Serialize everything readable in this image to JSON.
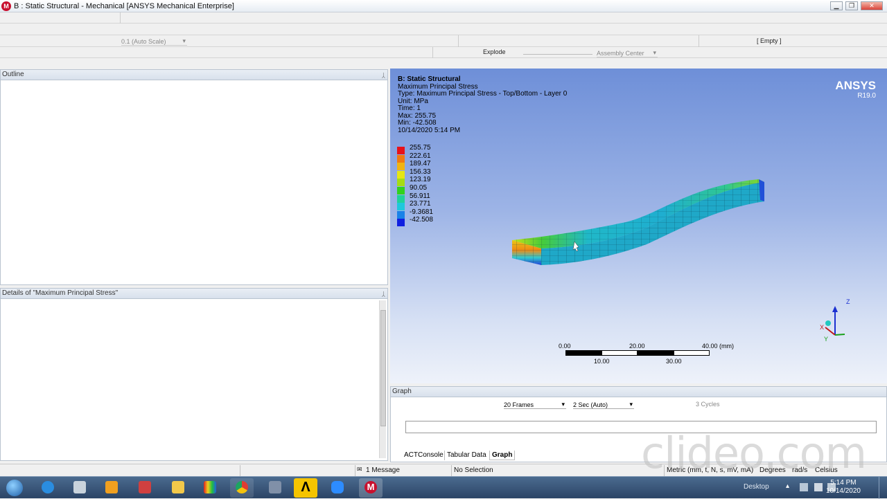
{
  "window": {
    "title": "B : Static Structural - Mechanical [ANSYS Mechanical Enterprise]",
    "app_icon_letter": "M",
    "min": "▁",
    "restore": "❐",
    "close": "✕"
  },
  "toolbar": {
    "scale": "0.1 (Auto Scale)",
    "empty": "[ Empty ]",
    "explode": "Explode",
    "assembly_center": "Assembly Center"
  },
  "outline": {
    "header": "Outline",
    "pin": "ᛸ"
  },
  "details": {
    "header": "Details of \"Maximum Principal Stress\"",
    "pin": "ᛸ"
  },
  "viewport": {
    "info": {
      "title": "B: Static Structural",
      "result": "Maximum Principal Stress",
      "type": "Type: Maximum Principal Stress - Top/Bottom - Layer 0",
      "unit": "Unit: MPa",
      "time": "Time: 1",
      "max": "Max: 255.75",
      "min": "Min: -42.508",
      "date": "10/14/2020 5:14 PM"
    },
    "legend": [
      {
        "value": "255.75",
        "color": "#e8121a"
      },
      {
        "value": "222.61",
        "color": "#f07a12"
      },
      {
        "value": "189.47",
        "color": "#f0b412"
      },
      {
        "value": "156.33",
        "color": "#e6e614"
      },
      {
        "value": "123.19",
        "color": "#a6dc14"
      },
      {
        "value": "90.05",
        "color": "#32d21e"
      },
      {
        "value": "56.911",
        "color": "#20d29a"
      },
      {
        "value": "23.771",
        "color": "#1ec8dc"
      },
      {
        "value": "-9.3681",
        "color": "#1a82e8"
      },
      {
        "value": "-42.508",
        "color": "#1020e0"
      }
    ],
    "logo": "ANSYS",
    "version": "R19.0",
    "scale_bar": {
      "top_labels": [
        "0.00",
        "20.00",
        "40.00 (mm)"
      ],
      "bottom_labels": [
        "10.00",
        "30.00"
      ]
    },
    "triad": {
      "z": "Z",
      "x": "X",
      "y": "Y"
    }
  },
  "graph": {
    "header": "Graph",
    "pin": "ᛸ",
    "frames": "20 Frames",
    "speed": "2 Sec (Auto)",
    "cycles": "3 Cycles"
  },
  "bottom_tabs": [
    "ACTConsole",
    "Tabular Data",
    "Graph"
  ],
  "status": {
    "messages": "1 Message",
    "selection": "No Selection",
    "units": "Metric (mm, t, N, s, mV, mA)",
    "angle": "Degrees",
    "rate": "rad/s",
    "temp": "Celsius"
  },
  "taskbar": {
    "desktop": "Desktop",
    "time": "5:14 PM",
    "date": "10/14/2020",
    "ansys_letter": "Λ",
    "mech_letter": "M"
  },
  "watermark": "clideo.com"
}
